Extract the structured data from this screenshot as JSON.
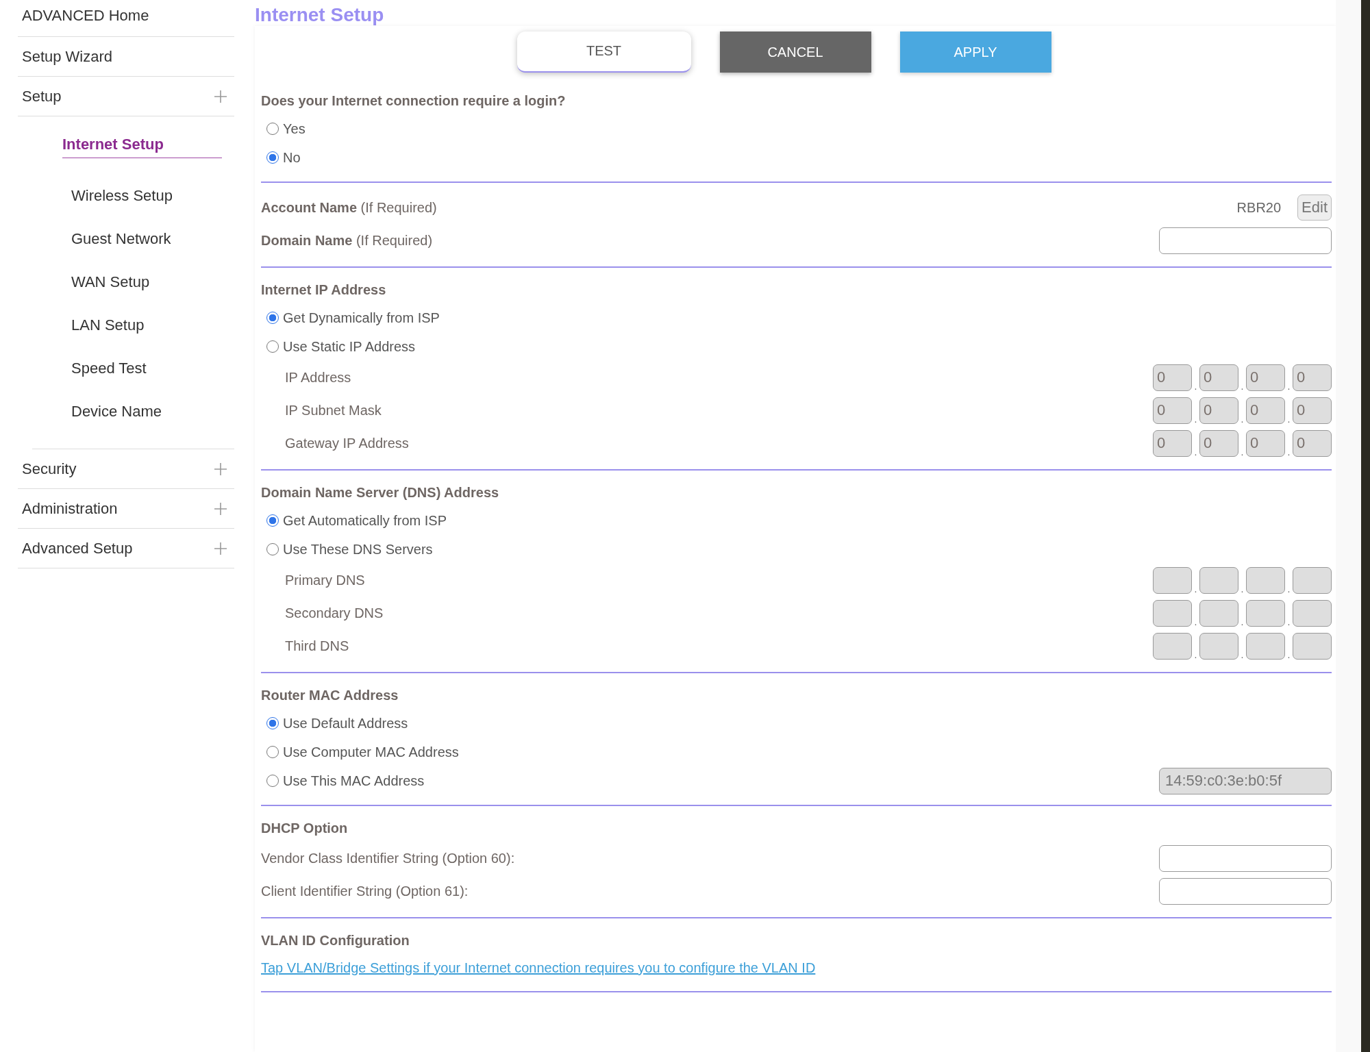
{
  "sidebar": {
    "items": [
      {
        "label": "ADVANCED Home",
        "kind": "link",
        "selected": false
      },
      {
        "label": "Setup Wizard",
        "kind": "link",
        "selected": false
      },
      {
        "label": "Setup",
        "kind": "group",
        "selected": false,
        "children": [
          {
            "label": "Internet Setup",
            "selected": true
          },
          {
            "label": "Wireless Setup",
            "selected": false
          },
          {
            "label": "Guest Network",
            "selected": false
          },
          {
            "label": "WAN Setup",
            "selected": false
          },
          {
            "label": "LAN Setup",
            "selected": false
          },
          {
            "label": "Speed Test",
            "selected": false
          },
          {
            "label": "Device Name",
            "selected": false
          }
        ]
      },
      {
        "label": "Security",
        "kind": "group",
        "selected": false
      },
      {
        "label": "Administration",
        "kind": "group",
        "selected": false
      },
      {
        "label": "Advanced Setup",
        "kind": "group",
        "selected": false
      }
    ]
  },
  "page_title": "Internet Setup",
  "buttons": [
    {
      "label": "TEST",
      "kind": "secondary"
    },
    {
      "label": "CANCEL",
      "kind": "neutral"
    },
    {
      "label": "APPLY",
      "kind": "primary"
    }
  ],
  "sections": [
    {
      "title": "Does your Internet connection require a login?",
      "rows": [
        {
          "kind": "radio",
          "label": "Yes",
          "selected": false
        },
        {
          "kind": "radio",
          "label": "No",
          "selected": true
        }
      ]
    },
    {
      "rows": [
        {
          "kind": "account",
          "label": "**Account Name**  (If Required)",
          "value": "RBR20",
          "button": "Edit"
        },
        {
          "kind": "text",
          "label": "**Domain Name**  (If Required)",
          "disabled": false
        }
      ]
    },
    {
      "title": "Internet IP Address",
      "rows": [
        {
          "kind": "radio",
          "label": "Get Dynamically from ISP",
          "selected": true
        },
        {
          "kind": "radio",
          "label": "Use Static IP Address",
          "selected": false
        },
        {
          "kind": "ip",
          "label": "IP Address",
          "disabled": true,
          "separator": ".",
          "octets": [
            "0",
            "0",
            "0",
            "0"
          ]
        },
        {
          "kind": "ip",
          "label": "IP Subnet Mask",
          "disabled": true,
          "separator": ".",
          "octets": [
            "0",
            "0",
            "0",
            "0"
          ]
        },
        {
          "kind": "ip",
          "label": "Gateway IP Address",
          "disabled": true,
          "separator": ".",
          "octets": [
            "0",
            "0",
            "0",
            "0"
          ]
        }
      ]
    },
    {
      "title": "Domain Name Server (DNS) Address",
      "rows": [
        {
          "kind": "radio",
          "label": "Get Automatically from ISP",
          "selected": true
        },
        {
          "kind": "radio",
          "label": "Use These DNS Servers",
          "selected": false
        },
        {
          "kind": "ip",
          "label": "Primary DNS",
          "disabled": true,
          "separator": "."
        },
        {
          "kind": "ip",
          "label": "Secondary DNS",
          "disabled": true,
          "separator": "."
        },
        {
          "kind": "ip",
          "label": "Third DNS",
          "disabled": true,
          "separator": "."
        }
      ]
    },
    {
      "title": "Router MAC Address",
      "rows": [
        {
          "kind": "radio",
          "label": "Use Default Address",
          "selected": true
        },
        {
          "kind": "radio",
          "label": "Use Computer MAC Address",
          "selected": false
        },
        {
          "kind": "radio",
          "label": "Use This MAC Address",
          "selected": false,
          "field": {
            "value": "14:59:c0:3e:b0:5f",
            "disabled": true
          }
        }
      ]
    },
    {
      "title": "DHCP Option",
      "rows": [
        {
          "kind": "text",
          "label": "Vendor Class Identifier String (Option 60):",
          "disabled": false
        },
        {
          "kind": "text",
          "label": "Client Identifier String (Option 61):",
          "disabled": false
        }
      ]
    },
    {
      "title": "VLAN ID Configuration",
      "rows": [
        {
          "kind": "link",
          "label": "Tap VLAN/Bridge Settings if your Internet connection requires you to configure the VLAN ID"
        }
      ]
    }
  ]
}
